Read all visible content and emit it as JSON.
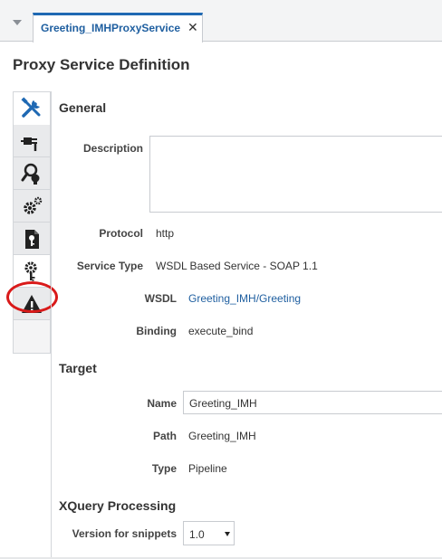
{
  "tab": {
    "title": "Greeting_IMHProxyService",
    "close_glyph": "✕"
  },
  "page": {
    "title": "Proxy Service Definition"
  },
  "sidebar": {
    "items": [
      {
        "icon": "tools-icon",
        "active": true
      },
      {
        "icon": "plug-icon",
        "active": false
      },
      {
        "icon": "search-bulb-icon",
        "active": false
      },
      {
        "icon": "gears-icon",
        "active": false
      },
      {
        "icon": "document-key-icon",
        "active": false
      },
      {
        "icon": "gear-key-icon",
        "active": false,
        "highlighted": true
      },
      {
        "icon": "warning-icon",
        "active": false
      }
    ]
  },
  "general": {
    "title": "General",
    "description_label": "Description",
    "description_value": "",
    "protocol_label": "Protocol",
    "protocol_value": "http",
    "service_type_label": "Service Type",
    "service_type_value": "WSDL Based Service - SOAP 1.1",
    "wsdl_label": "WSDL",
    "wsdl_value": "Greeting_IMH/Greeting",
    "binding_label": "Binding",
    "binding_value": "execute_bind"
  },
  "target": {
    "title": "Target",
    "name_label": "Name",
    "name_value": "Greeting_IMH",
    "path_label": "Path",
    "path_value": "Greeting_IMH",
    "type_label": "Type",
    "type_value": "Pipeline"
  },
  "xquery": {
    "title": "XQuery Processing",
    "version_label": "Version for snippets",
    "version_value": "1.0"
  },
  "colors": {
    "accent_blue": "#1f5fa0",
    "highlight_red": "#d91a1a",
    "icon_dark": "#222222"
  }
}
